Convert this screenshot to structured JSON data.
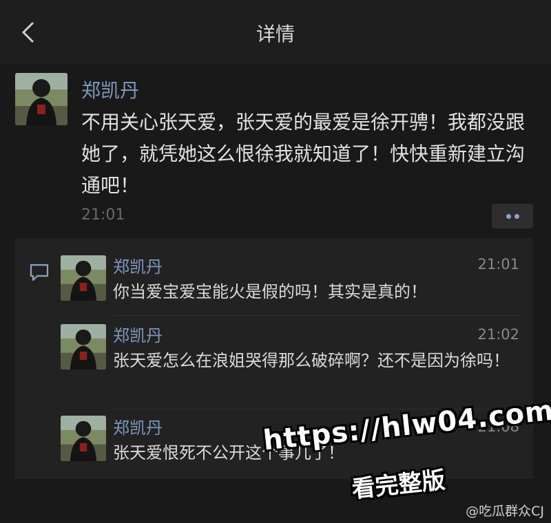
{
  "header": {
    "title": "详情",
    "back_icon": "chevron-left-icon"
  },
  "post": {
    "author": "郑凯丹",
    "text": "不用关心张天爱，张天爱的最爱是徐开骋！我都没跟她了，就凭她这么恨徐我就知道了！快快重新建立沟通吧！",
    "time": "21:01",
    "more_icon": "more-dots-icon"
  },
  "comments": {
    "icon": "comment-icon",
    "items": [
      {
        "author": "郑凯丹",
        "time": "21:01",
        "text": "你当爱宝爱宝能火是假的吗！其实是真的！"
      },
      {
        "author": "郑凯丹",
        "time": "21:02",
        "text": "张天爱怎么在浪姐哭得那么破碎啊？还不是因为徐吗！"
      },
      {
        "author": "郑凯丹",
        "time": "21:08",
        "text": "张天爱恨死不公开这个事儿了！"
      }
    ]
  },
  "watermark": {
    "url": "https://hlw04.com",
    "subtitle": "看完整版"
  },
  "credit": "@吃瓜群众CJ",
  "colors": {
    "background": "#191919",
    "topbar": "#1e1e1e",
    "name_link": "#7f97bd",
    "comment_panel": "#222222"
  }
}
